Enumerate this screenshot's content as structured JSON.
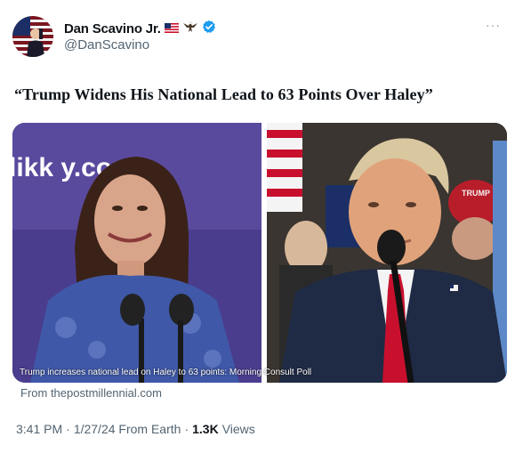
{
  "author": {
    "display_name": "Dan Scavino Jr.",
    "handle": "@DanScavino",
    "badges": [
      "us-flag-icon",
      "eagle-icon",
      "verified-badge-icon"
    ]
  },
  "tweet": {
    "headline": "“Trump Widens His National Lead to 63 Points Over Haley”",
    "more_label": "···"
  },
  "media": {
    "backdrop_text": "likk        y.com",
    "caption": "Trump increases national lead on Haley to 63 points: Morning Consult Poll",
    "hat_text": "TRUMP"
  },
  "link_source": "From thepostmillennial.com",
  "meta": {
    "time": "3:41 PM",
    "sep1": "·",
    "date": "1/27/24 From Earth",
    "sep2": "·",
    "views_count": "1.3K",
    "views_label": "Views"
  },
  "colors": {
    "verified": "#1d9bf0",
    "secondary_text": "#536471",
    "backdrop_purple": "#4b3d8e",
    "trump_tie": "#c8102e",
    "trump_suit": "#1f2a44"
  }
}
